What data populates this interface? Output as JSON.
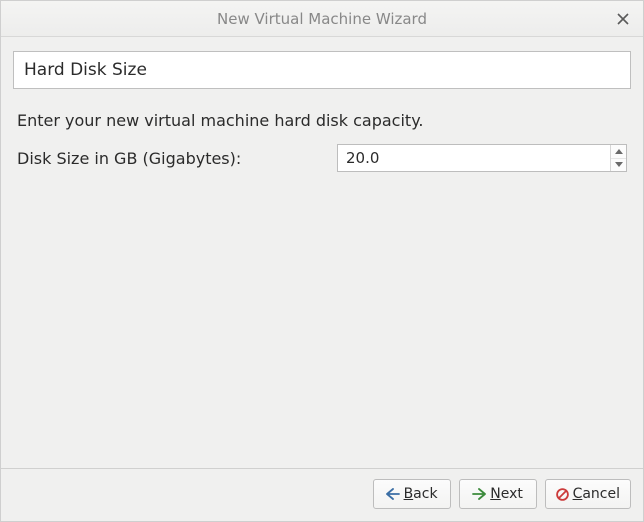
{
  "window": {
    "title": "New Virtual Machine Wizard"
  },
  "banner": {
    "title": "Hard Disk Size"
  },
  "intro": "Enter your new virtual machine hard disk capacity.",
  "form": {
    "disk_size_label": "Disk Size in GB (Gigabytes):",
    "disk_size_value": "20.0"
  },
  "buttons": {
    "back": "Back",
    "next": "Next",
    "cancel": "Cancel"
  },
  "icons": {
    "arrow_left": "arrow-left-icon",
    "arrow_right": "arrow-right-icon",
    "cancel": "cancel-icon"
  }
}
